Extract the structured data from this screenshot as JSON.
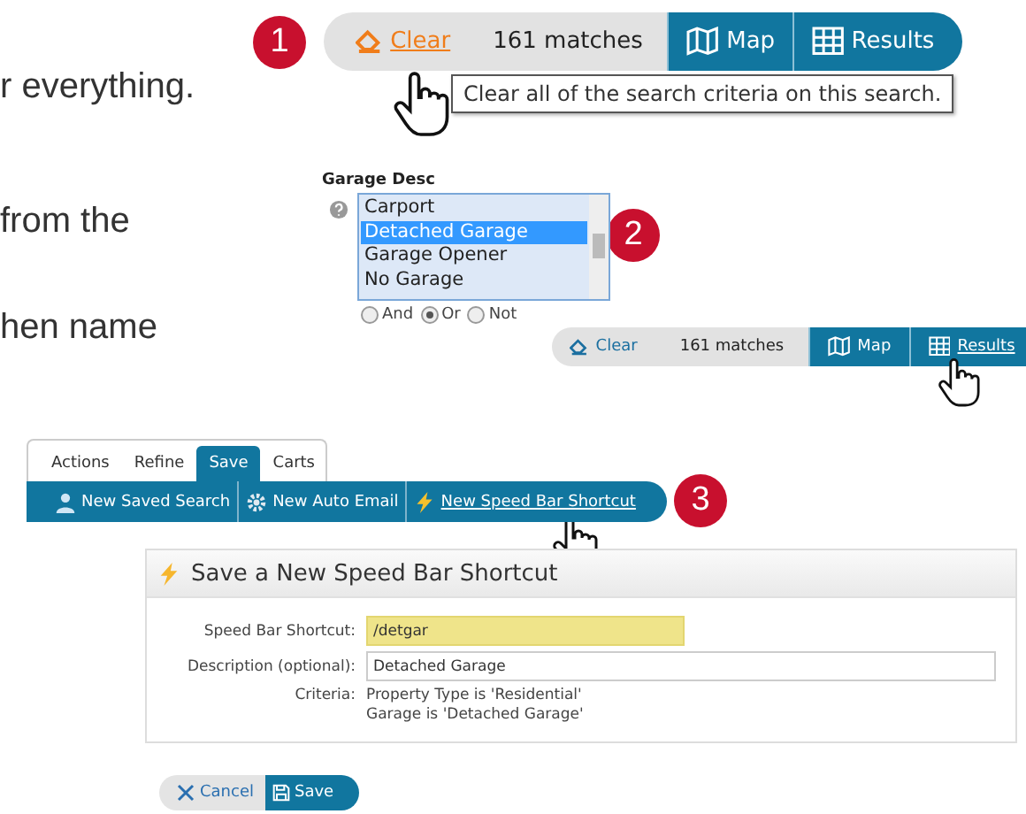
{
  "prose": [
    "r everything.",
    "from the",
    "hen name"
  ],
  "callout_numbers": [
    "1",
    "2",
    "3"
  ],
  "search_bars": [
    {
      "clear": "Clear",
      "clear_hover": true,
      "matches": "161 matches",
      "map": "Map",
      "results": "Results",
      "results_hover": false
    },
    {
      "clear": "Clear",
      "clear_hover": false,
      "matches": "161 matches",
      "map": "Map",
      "results": "Results",
      "results_hover": true
    }
  ],
  "tooltip": "Clear all of the search criteria on this search.",
  "garage": {
    "label": "Garage Desc",
    "options": [
      {
        "label": "Carport",
        "selected": false
      },
      {
        "label": "Detached Garage",
        "selected": true
      },
      {
        "label": "Garage Opener",
        "selected": false
      },
      {
        "label": "No Garage",
        "selected": false
      }
    ],
    "logic": [
      {
        "label": "And",
        "selected": false
      },
      {
        "label": "Or",
        "selected": true
      },
      {
        "label": "Not",
        "selected": false
      }
    ]
  },
  "tabs": [
    {
      "label": "Actions",
      "selected": false
    },
    {
      "label": "Refine",
      "selected": false
    },
    {
      "label": "Save",
      "selected": true
    },
    {
      "label": "Carts",
      "selected": false
    }
  ],
  "save_actions": [
    {
      "label": "New Saved Search",
      "kind": "saved-search",
      "hover": false
    },
    {
      "label": "New Auto Email",
      "kind": "auto-email",
      "hover": false
    },
    {
      "label": "New Speed Bar Shortcut",
      "kind": "shortcut",
      "hover": true
    }
  ],
  "dialog": {
    "title": "Save a New Speed Bar Shortcut",
    "fields": [
      {
        "label": "Speed Bar Shortcut:",
        "value": "/detgar",
        "highlighted": true
      },
      {
        "label": "Description (optional):",
        "value": "Detached Garage",
        "highlighted": false
      }
    ],
    "criteria_label": "Criteria:",
    "criteria": [
      "Property Type is 'Residential'",
      "Garage is 'Detached Garage'"
    ]
  },
  "buttons": [
    {
      "label": "Cancel",
      "kind": "cancel"
    },
    {
      "label": "Save",
      "kind": "save"
    }
  ]
}
